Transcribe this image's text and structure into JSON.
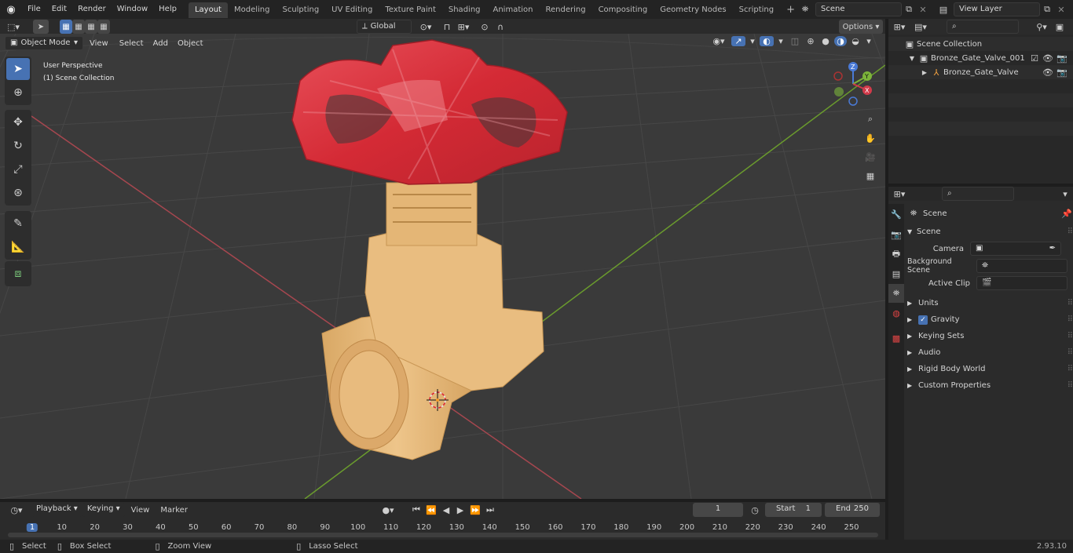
{
  "menubar": {
    "items": [
      "File",
      "Edit",
      "Render",
      "Window",
      "Help"
    ],
    "workspaces": [
      "Layout",
      "Modeling",
      "Sculpting",
      "UV Editing",
      "Texture Paint",
      "Shading",
      "Animation",
      "Rendering",
      "Compositing",
      "Geometry Nodes",
      "Scripting"
    ],
    "active_workspace": "Layout",
    "add_tab": "+",
    "scene_name": "Scene",
    "view_layer": "View Layer"
  },
  "viewport_header": {
    "mode": "Object Mode",
    "menus": [
      "View",
      "Select",
      "Add",
      "Object"
    ],
    "transform_orientation": "Global",
    "options_label": "Options"
  },
  "viewport": {
    "perspective_label": "User Perspective",
    "collection_label": "(1) Scene Collection",
    "gizmo_axes": [
      "Z",
      "Y",
      "X"
    ]
  },
  "outliner": {
    "rows": [
      {
        "label": "Scene Collection"
      },
      {
        "label": "Bronze_Gate_Valve_001"
      },
      {
        "label": "Bronze_Gate_Valve"
      }
    ]
  },
  "properties": {
    "header": "Scene",
    "panel": "Scene",
    "fields": [
      {
        "label": "Camera",
        "value": ""
      },
      {
        "label": "Background Scene",
        "value": ""
      },
      {
        "label": "Active Clip",
        "value": ""
      }
    ],
    "sections": [
      "Units",
      "Gravity",
      "Keying Sets",
      "Audio",
      "Rigid Body World",
      "Custom Properties"
    ],
    "gravity_checked": true
  },
  "timeline": {
    "menus": [
      "Playback",
      "Keying",
      "View",
      "Marker"
    ],
    "current_frame": "1",
    "start_label": "Start",
    "start_value": "1",
    "end_label": "End",
    "end_value": "250",
    "ticks": [
      "1",
      "10",
      "20",
      "30",
      "40",
      "50",
      "60",
      "70",
      "80",
      "90",
      "100",
      "110",
      "120",
      "130",
      "140",
      "150",
      "160",
      "170",
      "180",
      "190",
      "200",
      "210",
      "220",
      "230",
      "240",
      "250"
    ]
  },
  "statusbar": {
    "select": "Select",
    "box_select": "Box Select",
    "zoom_view": "Zoom View",
    "lasso_select": "Lasso Select",
    "version": "2.93.10"
  },
  "colors": {
    "accent": "#4772b3",
    "handle_red": "#d8343a",
    "body_bronze": "#e7b978",
    "grid_x": "#a6474f",
    "grid_y": "#6a9b2d"
  }
}
